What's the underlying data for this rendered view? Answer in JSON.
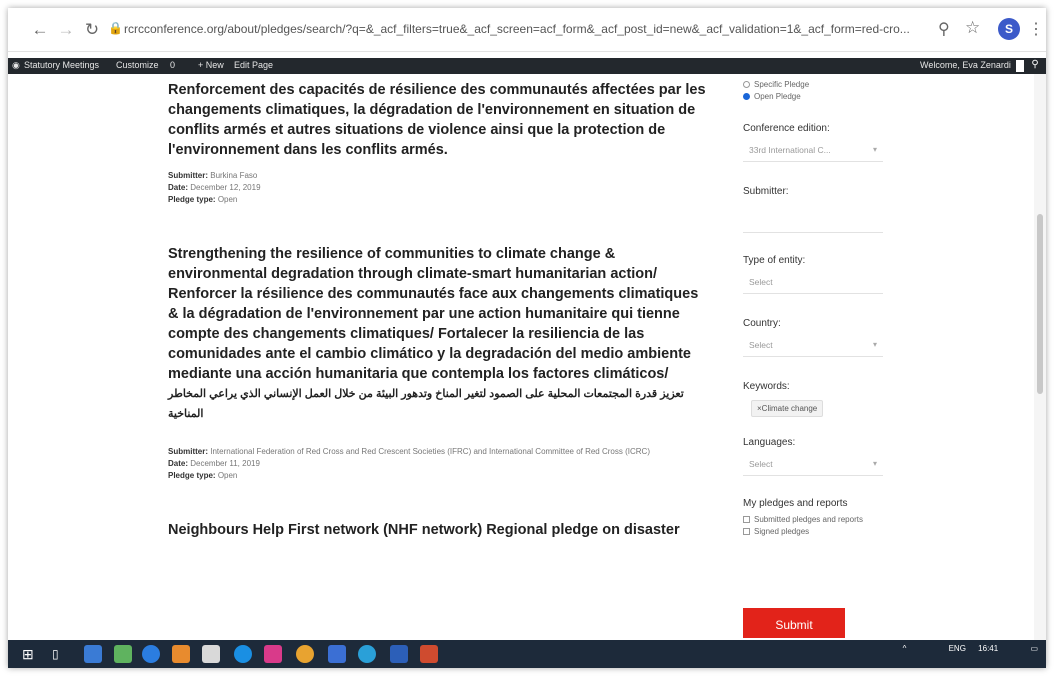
{
  "browser": {
    "url": "rcrcconference.org/about/pledges/search/?q=&_acf_filters=true&_acf_screen=acf_form&_acf_post_id=new&_acf_validation=1&_acf_form=red-cro...",
    "profile_initial": "S"
  },
  "admin_bar": {
    "items": [
      "Statutory Meetings",
      "Customize",
      "0",
      "+ New",
      "Edit Page"
    ],
    "welcome": "Welcome, Eva Zenardi"
  },
  "pledges": [
    {
      "title": "Renforcement des capacités de résilience des communautés affectées par les changements climatiques, la dégradation de l'environnement en situation de conflits armés et autres situations de violence ainsi que la protection de l'environnement dans les conflits armés.",
      "submitter_label": "Submitter:",
      "submitter": "Burkina Faso",
      "date_label": "Date:",
      "date": "December 12, 2019",
      "type_label": "Pledge type:",
      "type": "Open"
    },
    {
      "title": "Strengthening the resilience of communities to climate change & environmental degradation through climate-smart humanitarian action/ Renforcer la résilience des communautés face aux changements climatiques & la dégradation de l'environnement par une action humanitaire qui tienne compte des changements climatiques/ Fortalecer la resiliencia de las comunidades ante el cambio climático y la degradación del medio ambiente mediante una acción humanitaria que contempla los factores climáticos/",
      "title_arabic": "تعزيز قدرة المجتمعات المحلية على الصمود لتغير المناخ وتدهور البيئة من خلال العمل الإنساني الذي يراعي المخاطر المناخية",
      "submitter_label": "Submitter:",
      "submitter": "International Federation of Red Cross and Red Crescent Societies (IFRC) and International Committee of Red Cross (ICRC)",
      "date_label": "Date:",
      "date": "December 11, 2019",
      "type_label": "Pledge type:",
      "type": "Open"
    },
    {
      "title": "Neighbours Help First network (NHF network) Regional pledge on disaster"
    }
  ],
  "sidebar": {
    "radio_specific": "Specific Pledge",
    "radio_open": "Open Pledge",
    "edition_label": "Conference edition:",
    "edition_value": "33rd International C...",
    "submitter_label": "Submitter:",
    "entity_label": "Type of entity:",
    "entity_placeholder": "Select",
    "country_label": "Country:",
    "country_placeholder": "Select",
    "keywords_label": "Keywords:",
    "keyword_tag": "×Climate change",
    "languages_label": "Languages:",
    "languages_placeholder": "Select",
    "my_pledges_label": "My pledges and reports",
    "check_submitted": "Submitted pledges and reports",
    "check_signed": "Signed pledges",
    "submit_label": "Submit"
  },
  "taskbar": {
    "time": "16:41",
    "lang": "ENG"
  },
  "colors": {
    "submit": "#e2231a",
    "adminbar": "#23282d",
    "taskbar": "#1d2a3a"
  }
}
